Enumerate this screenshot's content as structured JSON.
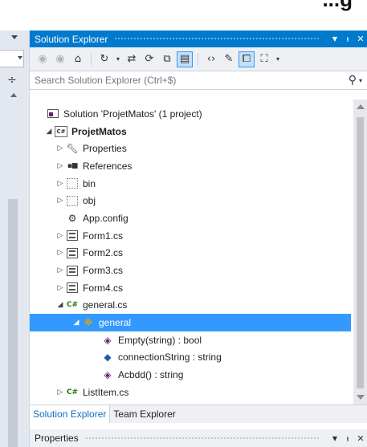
{
  "top_partial_text": "...g",
  "panel": {
    "title": "Solution Explorer",
    "controls": {
      "dropdown": "▼",
      "pin": "ᵼ",
      "close": "✕"
    }
  },
  "toolbar": {
    "icons": [
      "back-icon",
      "forward-icon",
      "home-icon",
      "history-icon",
      "sync-icon",
      "refresh-icon",
      "collapse-all-icon",
      "show-all-files-icon",
      "view-code-icon",
      "properties-icon",
      "preview-icon",
      "class-diagram-icon"
    ]
  },
  "search": {
    "placeholder": "Search Solution Explorer (Ctrl+$)"
  },
  "tree": {
    "solution": "Solution 'ProjetMatos' (1 project)",
    "project": "ProjetMatos",
    "properties": "Properties",
    "references": "References",
    "bin": "bin",
    "obj": "obj",
    "app_config": "App.config",
    "form1": "Form1.cs",
    "form2": "Form2.cs",
    "form3": "Form3.cs",
    "form4": "Form4.cs",
    "general_cs": "general.cs",
    "general_class": "general",
    "member_empty": "Empty(string) : bool",
    "member_connection": "connectionString : string",
    "member_acbdd": "Acbdd() : string",
    "listitem": "ListItem.cs"
  },
  "tabs": {
    "solution_explorer": "Solution Explorer",
    "team_explorer": "Team Explorer"
  },
  "properties_panel": {
    "title": "Properties"
  },
  "colors": {
    "accent": "#007acc",
    "selection": "#3399ff",
    "background": "#eef0f4"
  }
}
